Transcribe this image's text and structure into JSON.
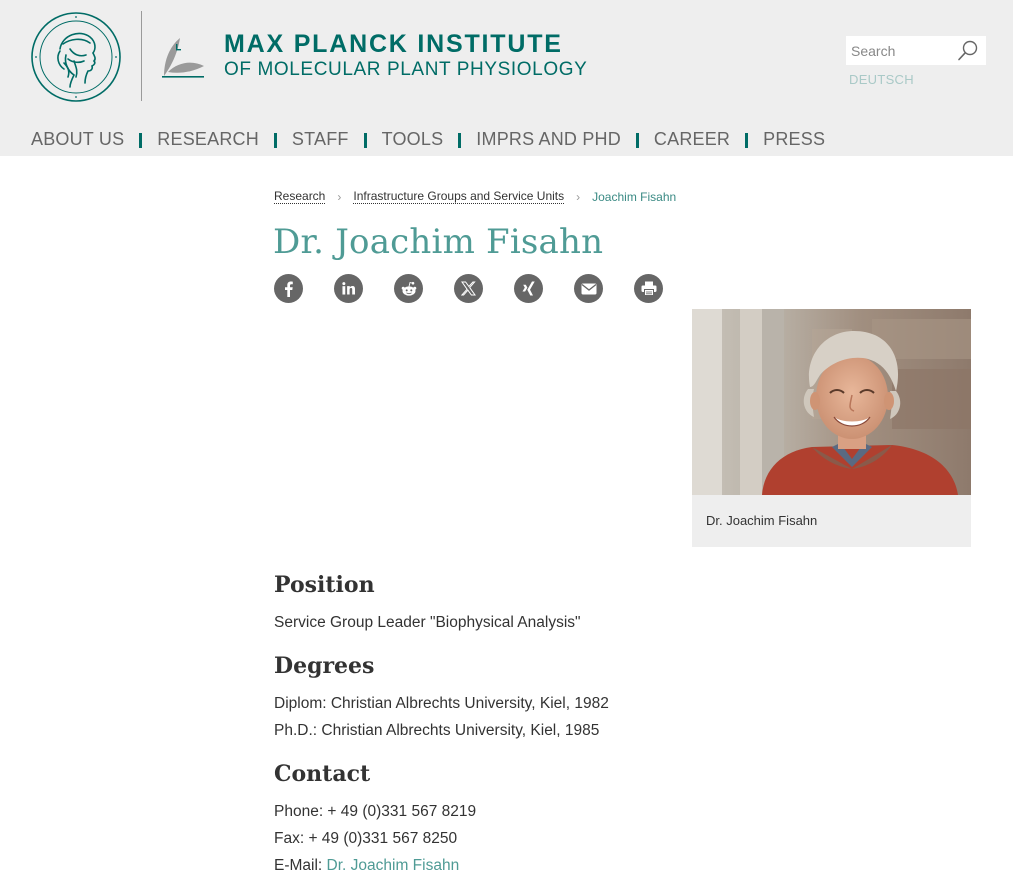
{
  "header": {
    "institute_name": "MAX PLANCK INSTITUTE",
    "institute_sub": "OF MOLECULAR PLANT PHYSIOLOGY",
    "search_placeholder": "Search",
    "language_link": "DEUTSCH",
    "brand_color": "#006c66",
    "background": "#eeeeee"
  },
  "nav": {
    "items": [
      {
        "label": "ABOUT US"
      },
      {
        "label": "RESEARCH"
      },
      {
        "label": "STAFF"
      },
      {
        "label": "TOOLS"
      },
      {
        "label": "IMPRS AND PHD"
      },
      {
        "label": "CAREER"
      },
      {
        "label": "PRESS"
      }
    ]
  },
  "breadcrumb": {
    "items": [
      {
        "label": "Research"
      },
      {
        "label": "Infrastructure Groups and Service Units"
      }
    ],
    "current": "Joachim Fisahn"
  },
  "page": {
    "title": "Dr. Joachim Fisahn",
    "title_color": "#4f9b95"
  },
  "share": {
    "icons": [
      "facebook-icon",
      "linkedin-icon",
      "reddit-icon",
      "x-icon",
      "xing-icon",
      "email-icon",
      "print-icon"
    ]
  },
  "photo": {
    "caption": "Dr. Joachim Fisahn"
  },
  "sections": {
    "position": {
      "heading": "Position",
      "text": "Service Group Leader \"Biophysical Analysis\""
    },
    "degrees": {
      "heading": "Degrees",
      "lines": [
        "Diplom: Christian Albrechts University, Kiel, 1982",
        "Ph.D.: Christian Albrechts University, Kiel, 1985"
      ]
    },
    "contact": {
      "heading": "Contact",
      "phone": "Phone: + 49 (0)331 567 8219",
      "fax": "Fax: + 49 (0)331 567 8250",
      "email_label": "E-Mail: ",
      "email_link": "Dr. Joachim Fisahn"
    }
  }
}
